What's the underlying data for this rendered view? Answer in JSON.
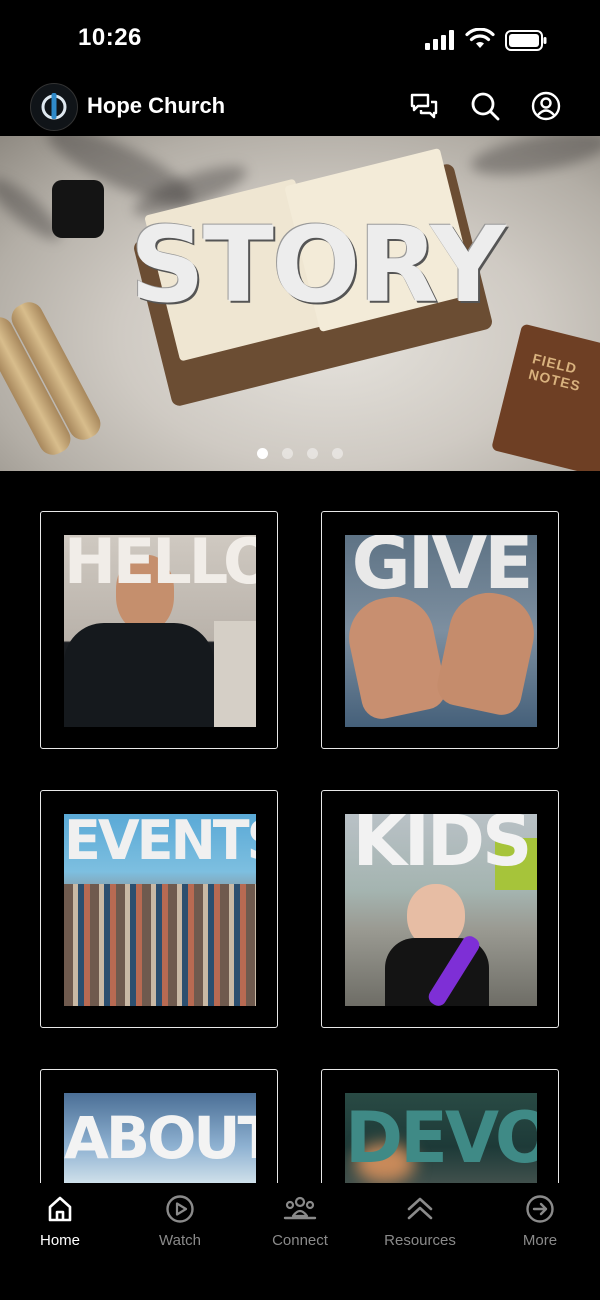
{
  "status_bar": {
    "time": "10:26"
  },
  "header": {
    "app_name": "Hope Church"
  },
  "hero": {
    "title": "STORY",
    "notebook_text": "FIELD NOTES",
    "slide_count": 4,
    "active_slide": 1
  },
  "tiles": [
    {
      "word": "HELLO"
    },
    {
      "word": "GIVE"
    },
    {
      "word": "EVENTS"
    },
    {
      "word": "KIDS"
    },
    {
      "word": "ABOUT"
    },
    {
      "word": "DEVO"
    }
  ],
  "nav": {
    "items": [
      {
        "label": "Home",
        "icon": "home-icon",
        "active": true
      },
      {
        "label": "Watch",
        "icon": "play-circle-icon",
        "active": false
      },
      {
        "label": "Connect",
        "icon": "group-icon",
        "active": false
      },
      {
        "label": "Resources",
        "icon": "double-chevron-up-icon",
        "active": false
      },
      {
        "label": "More",
        "icon": "arrow-circle-right-icon",
        "active": false
      }
    ]
  },
  "colors": {
    "background": "#000000",
    "text": "#ffffff",
    "inactive": "#8a8a8a"
  }
}
